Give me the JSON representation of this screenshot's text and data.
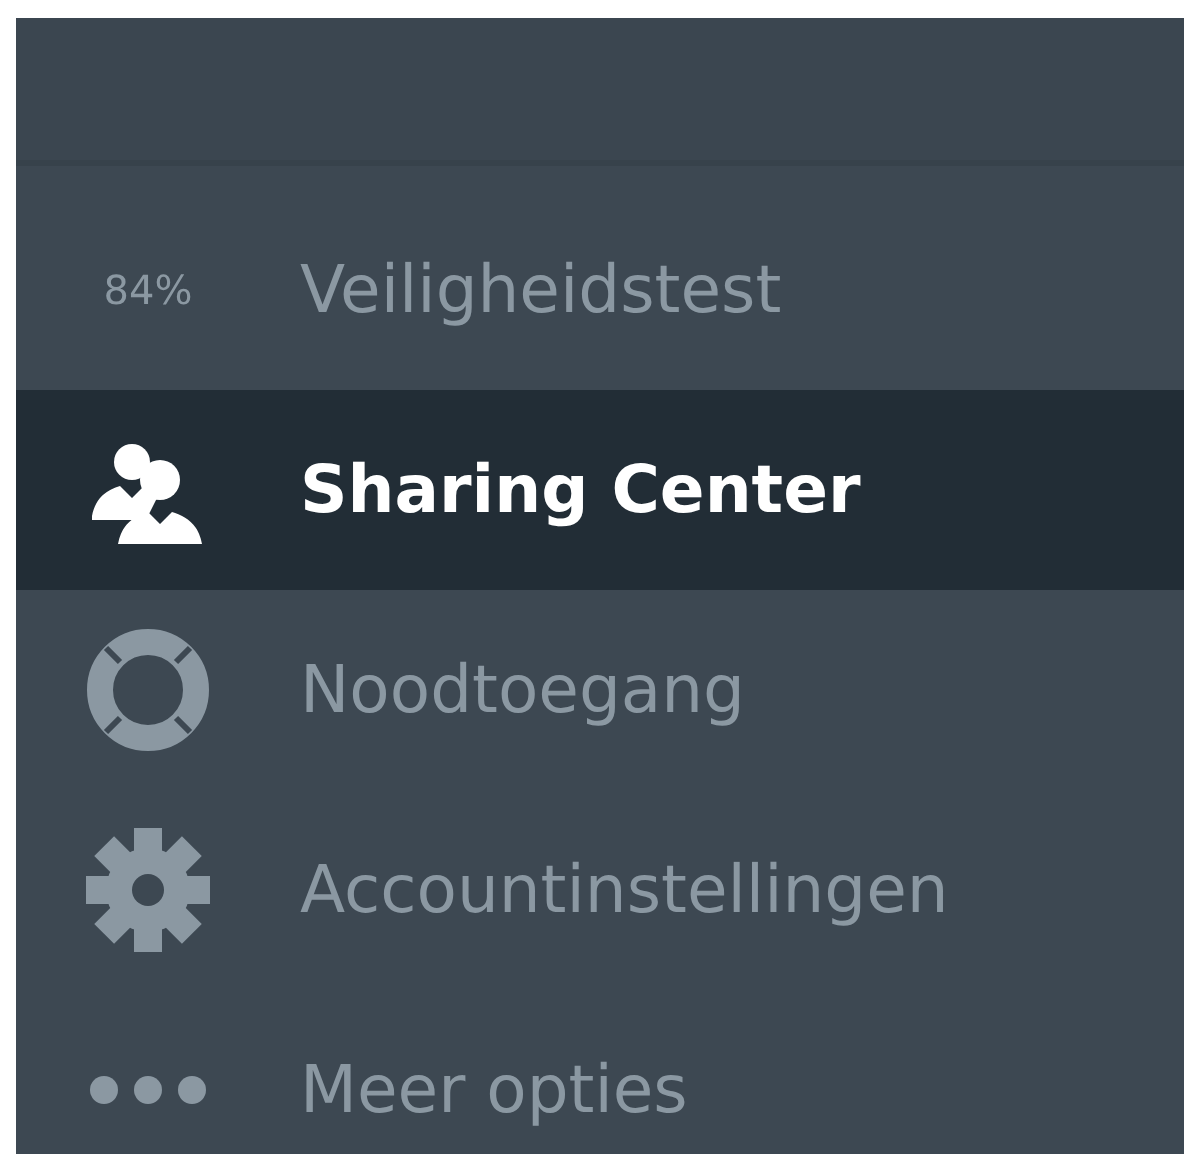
{
  "menu": {
    "items": [
      {
        "kind": "score",
        "score": "84%",
        "label": "Veiligheidstest",
        "selected": false
      },
      {
        "kind": "people",
        "label": "Sharing Center",
        "selected": true
      },
      {
        "kind": "lifebuoy",
        "label": "Noodtoegang",
        "selected": false
      },
      {
        "kind": "gear",
        "label": "Accountinstellingen",
        "selected": false
      },
      {
        "kind": "dots",
        "label": "Meer opties",
        "selected": false
      }
    ]
  }
}
